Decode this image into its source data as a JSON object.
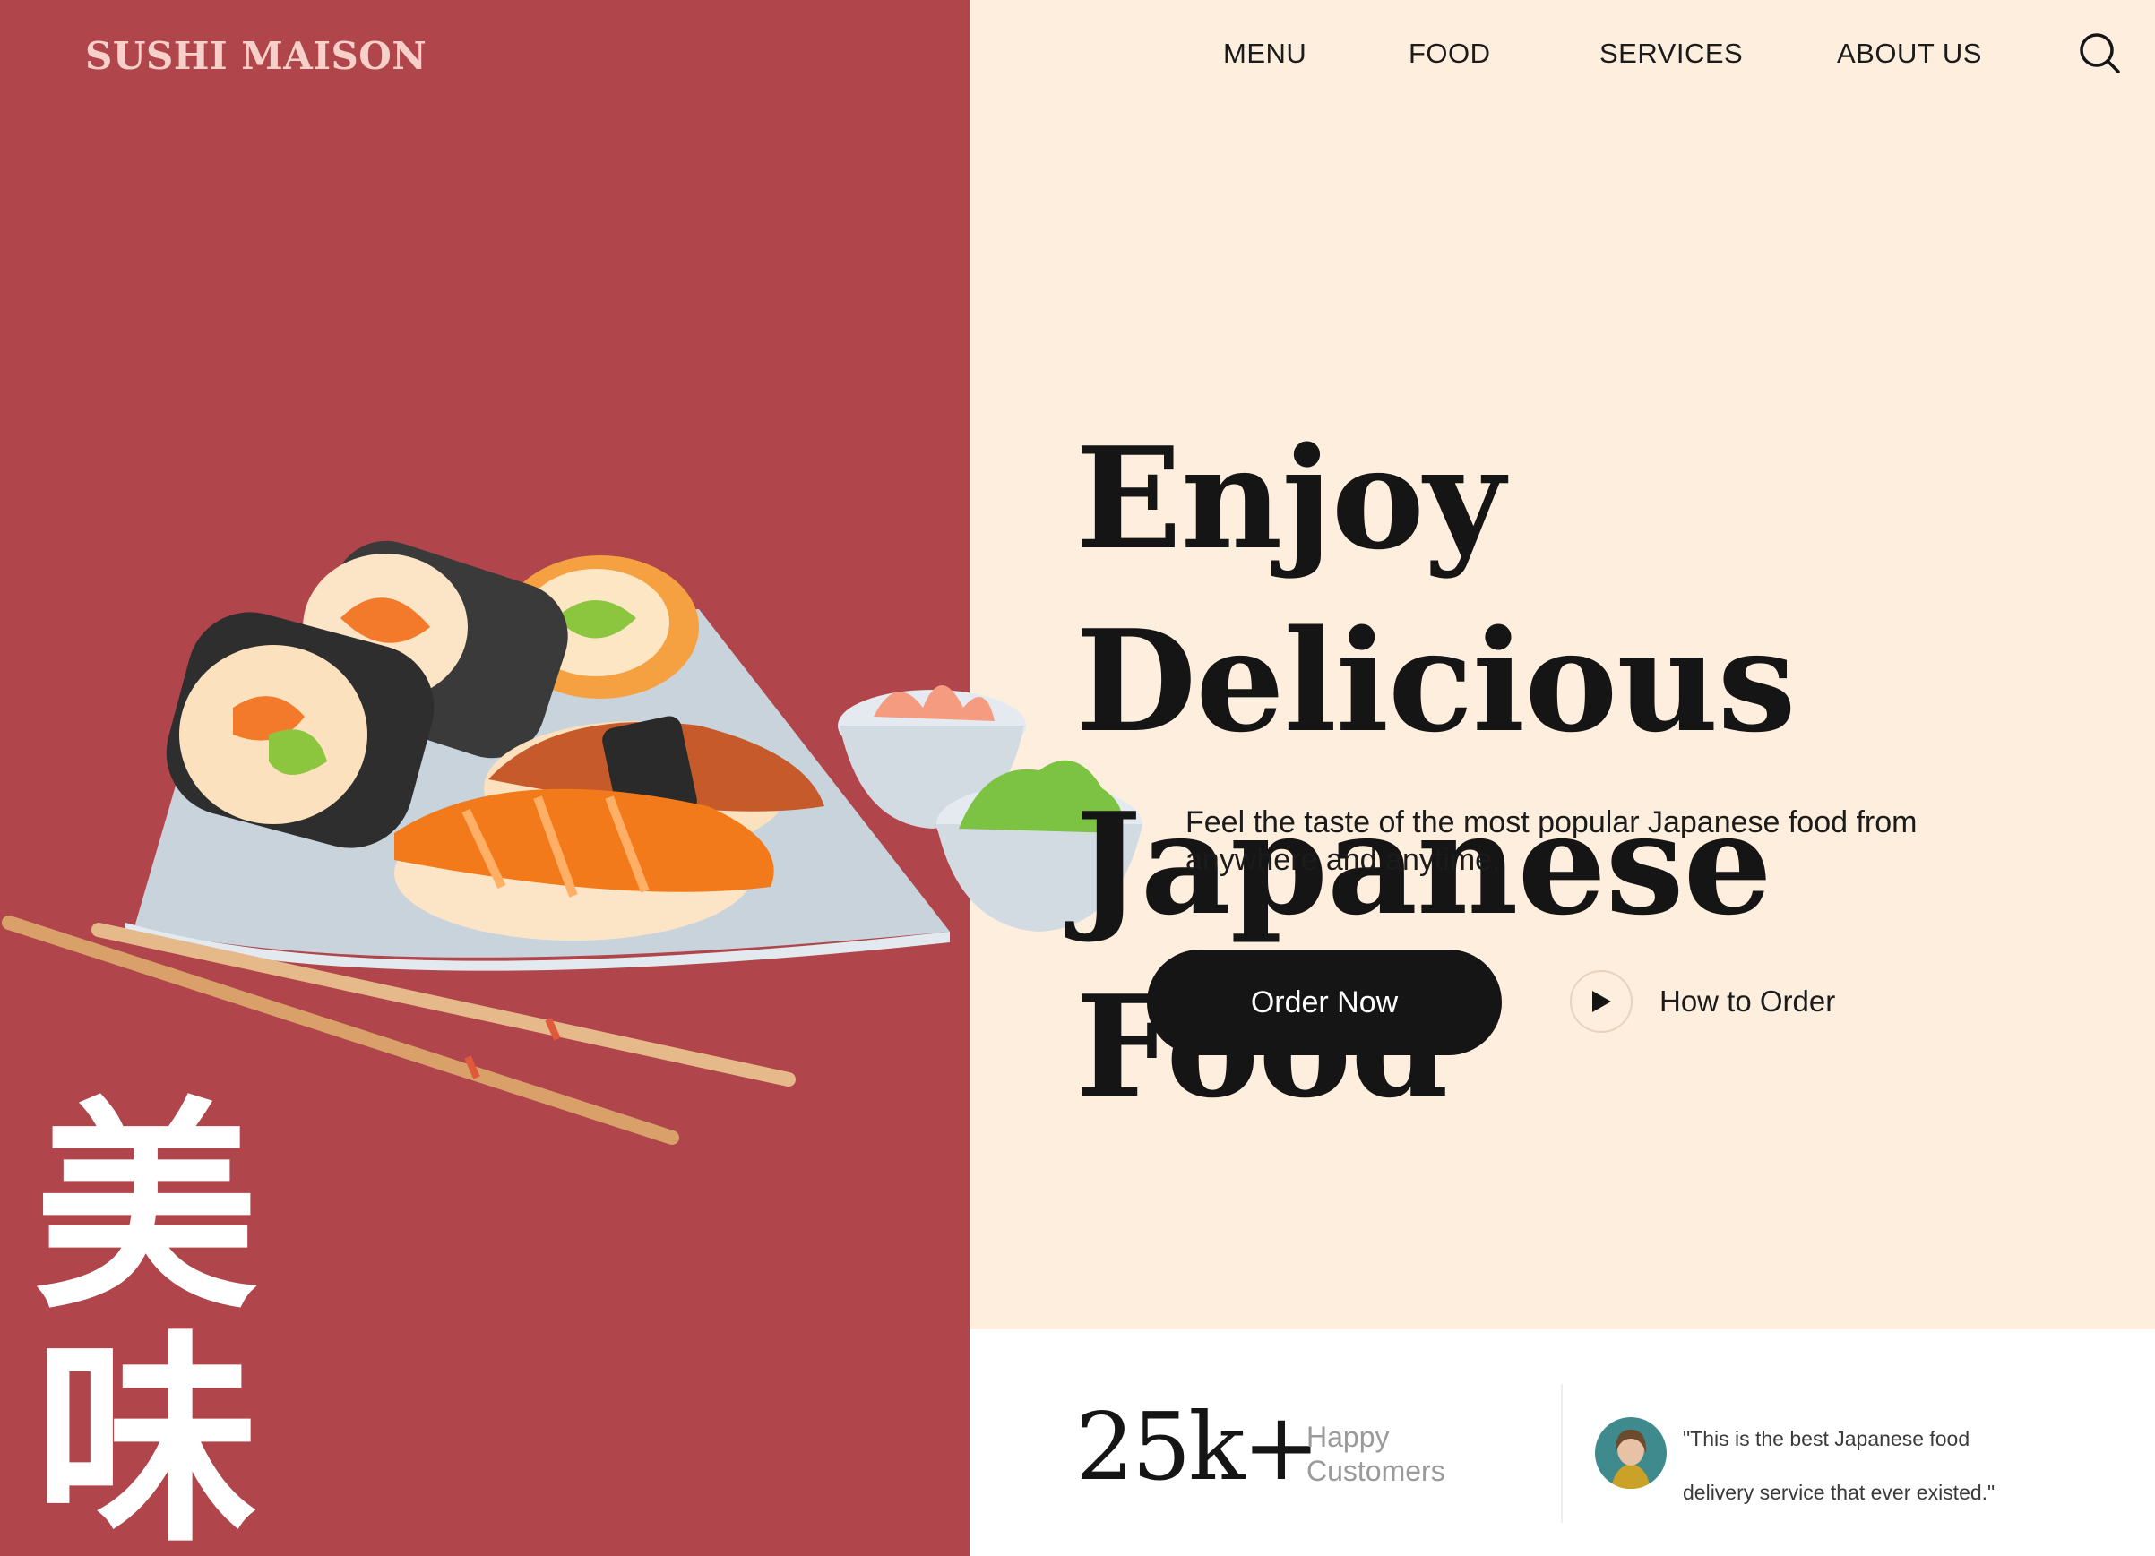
{
  "brand": {
    "name": "SUSHI MAISON"
  },
  "nav": {
    "menu": "MENU",
    "food": "FOOD",
    "services": "SERVICES",
    "about": "ABOUT US",
    "search_icon": "search-icon"
  },
  "hero": {
    "title_line1": "Enjoy Delicious",
    "title_line2": "Japanese Food",
    "subtitle": "Feel the taste of the most popular Japanese food from anywhere and anytime.",
    "order_button": "Order Now",
    "how_to_order": "How to Order",
    "play_icon": "play-icon"
  },
  "decor": {
    "kanji_1": "美",
    "kanji_2": "味"
  },
  "stats": {
    "number": "25k+",
    "label_line1": "Happy",
    "label_line2": "Customers"
  },
  "testimonial": {
    "quote_line1": "\"This is the best Japanese food",
    "quote_line2": "delivery service that ever existed.\""
  },
  "colors": {
    "brand_red": "#b0464b",
    "cream": "#fdeedd",
    "dark": "#151515",
    "brand_text": "#f7d0c9"
  }
}
